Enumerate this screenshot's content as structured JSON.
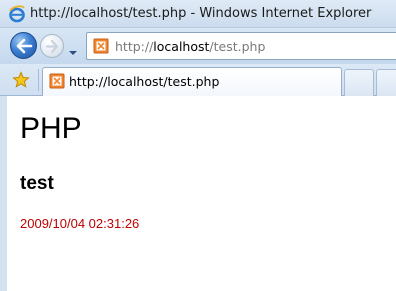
{
  "window": {
    "title": "http://localhost/test.php - Windows Internet Explorer",
    "app_icon": "ie-icon"
  },
  "navigation": {
    "back_icon": "back-arrow-icon",
    "forward_icon": "forward-arrow-icon",
    "history_dropdown_icon": "chevron-down-icon",
    "address": {
      "prefix": "http://",
      "host": "localhost",
      "path": "/test.php",
      "site_icon": "page-icon"
    }
  },
  "tabs": {
    "favorites_icon": "star-icon",
    "active": {
      "label": "http://localhost/test.php",
      "icon": "page-icon"
    }
  },
  "page": {
    "heading1": "PHP",
    "heading2": "test",
    "timestamp": "2009/10/04 02:31:26",
    "timestamp_color": "#c00000"
  }
}
